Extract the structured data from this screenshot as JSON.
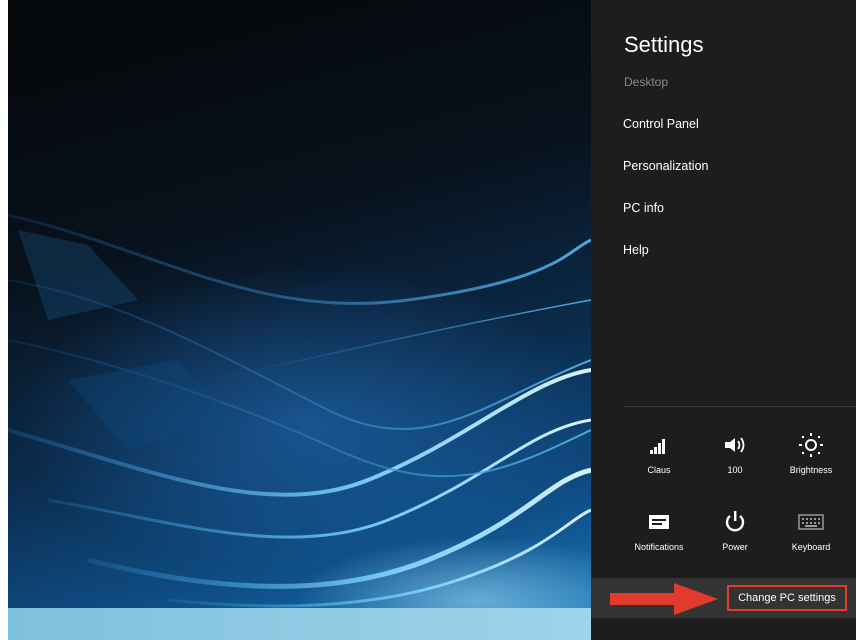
{
  "charms": {
    "title": "Settings",
    "subtitle": "Desktop",
    "menu": [
      {
        "label": "Control Panel"
      },
      {
        "label": "Personalization"
      },
      {
        "label": "PC info"
      },
      {
        "label": "Help"
      }
    ],
    "quick_settings": [
      {
        "label": "Claus",
        "icon": "network-signal-icon"
      },
      {
        "label": "100",
        "icon": "volume-icon"
      },
      {
        "label": "Brightness",
        "icon": "brightness-icon"
      },
      {
        "label": "Notifications",
        "icon": "notifications-icon"
      },
      {
        "label": "Power",
        "icon": "power-icon"
      },
      {
        "label": "Keyboard",
        "icon": "keyboard-icon"
      }
    ],
    "change_pc_settings": "Change PC settings"
  },
  "colors": {
    "charms_bg": "#1d1d1d",
    "highlight": "#e23a2c"
  }
}
